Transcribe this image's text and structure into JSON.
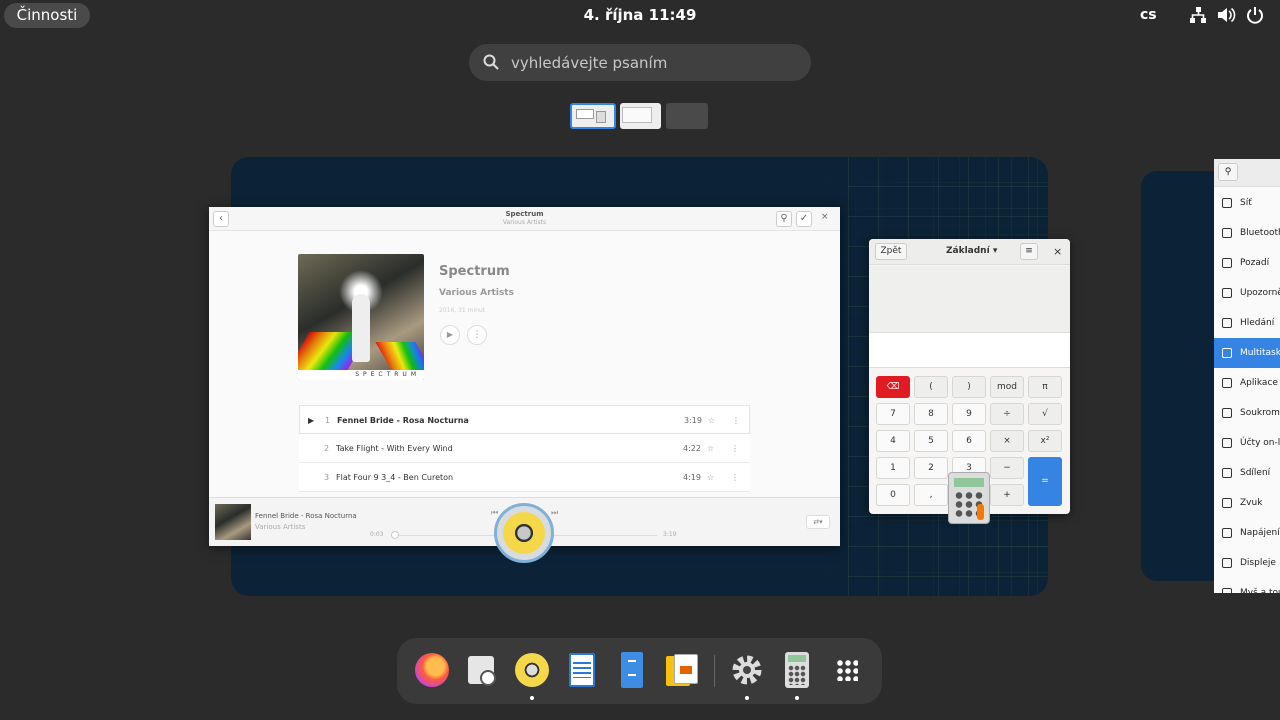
{
  "topbar": {
    "activities": "Činnosti",
    "clock": "4. října  11:49",
    "lang": "cs"
  },
  "search": {
    "placeholder": "vyhledávejte psaním"
  },
  "music": {
    "header_title": "Spectrum",
    "header_subtitle": "Various Artists",
    "album_title": "Spectrum",
    "album_artist": "Various Artists",
    "album_meta": "2016, 31 minut",
    "cover_label": "SPECTRUM",
    "tracks": [
      {
        "num": "1",
        "title": "Fennel Bride - Rosa Nocturna",
        "duration": "3:19"
      },
      {
        "num": "2",
        "title": "Take Flight - With Every Wind",
        "duration": "4:22"
      },
      {
        "num": "3",
        "title": "Flat Four 9 3_4 - Ben Cureton",
        "duration": "4:19"
      }
    ],
    "now_playing_title": "Fennel Bride - Rosa Nocturna",
    "now_playing_artist": "Various Artists",
    "elapsed": "0:03",
    "total": "3:19",
    "progress": 0.015
  },
  "calculator": {
    "back": "Zpět",
    "mode": "Základní",
    "keys": [
      [
        "⌫",
        "(",
        ")",
        "mod",
        "π"
      ],
      [
        "7",
        "8",
        "9",
        "÷",
        "√"
      ],
      [
        "4",
        "5",
        "6",
        "×",
        "x²"
      ],
      [
        "1",
        "2",
        "3",
        "−",
        "="
      ],
      [
        "0",
        ",",
        "%",
        "+"
      ]
    ]
  },
  "settings": {
    "items": [
      {
        "label": "Síť",
        "icon": "network-icon"
      },
      {
        "label": "Bluetooth",
        "icon": "bluetooth-icon"
      },
      {
        "label": "Pozadí",
        "icon": "background-icon"
      },
      {
        "label": "Upozorně",
        "icon": "bell-icon"
      },
      {
        "label": "Hledání",
        "icon": "search-icon"
      },
      {
        "label": "Multitask",
        "icon": "multitasking-icon",
        "selected": true
      },
      {
        "label": "Aplikace",
        "icon": "apps-icon"
      },
      {
        "label": "Soukromí",
        "icon": "hand-icon"
      },
      {
        "label": "Účty on-li",
        "icon": "at-icon"
      },
      {
        "label": "Sdílení",
        "icon": "share-icon"
      },
      {
        "label": "Zvuk",
        "icon": "speaker-icon"
      },
      {
        "label": "Napájení",
        "icon": "power-icon"
      },
      {
        "label": "Displeje",
        "icon": "display-icon"
      },
      {
        "label": "Myš a tou",
        "icon": "mouse-icon"
      }
    ]
  },
  "dock": {
    "apps": [
      "firefox",
      "evolution",
      "rhythmbox",
      "writer",
      "files",
      "impress",
      "settings",
      "calculator",
      "app-grid"
    ]
  },
  "colors": {
    "accent": "#3584e4",
    "destructive": "#e01b24"
  }
}
